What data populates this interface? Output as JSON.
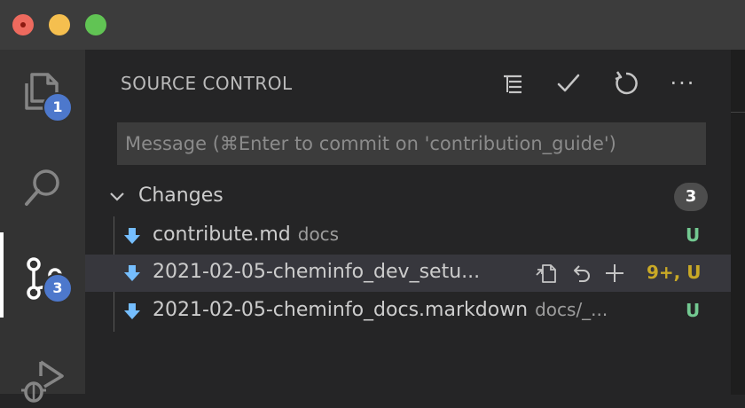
{
  "window": {
    "traffic_lights": [
      "close",
      "minimize",
      "zoom"
    ]
  },
  "activity_bar": {
    "explorer_badge": "1",
    "scm_badge": "3"
  },
  "scm": {
    "title": "SOURCE CONTROL",
    "toolbar_icons": [
      "view-as-tree-icon",
      "commit-check-icon",
      "refresh-icon",
      "more-actions-icon"
    ],
    "toolbar_more": "···",
    "commit_placeholder": "Message (⌘Enter to commit on 'contribution_guide')",
    "changes": {
      "label": "Changes",
      "count": "3",
      "files": [
        {
          "name": "contribute.md",
          "path": "docs",
          "status": "U"
        },
        {
          "name": "2021-02-05-cheminfo_dev_setu...",
          "path": "",
          "status": "9+, U"
        },
        {
          "name": "2021-02-05-cheminfo_docs.markdown",
          "path": "docs/_...",
          "status": "U"
        }
      ]
    }
  },
  "colors": {
    "accent_badge": "#4d78cc",
    "untracked": "#73c991",
    "problems": "#c9a926",
    "file_icon": "#75beff"
  }
}
